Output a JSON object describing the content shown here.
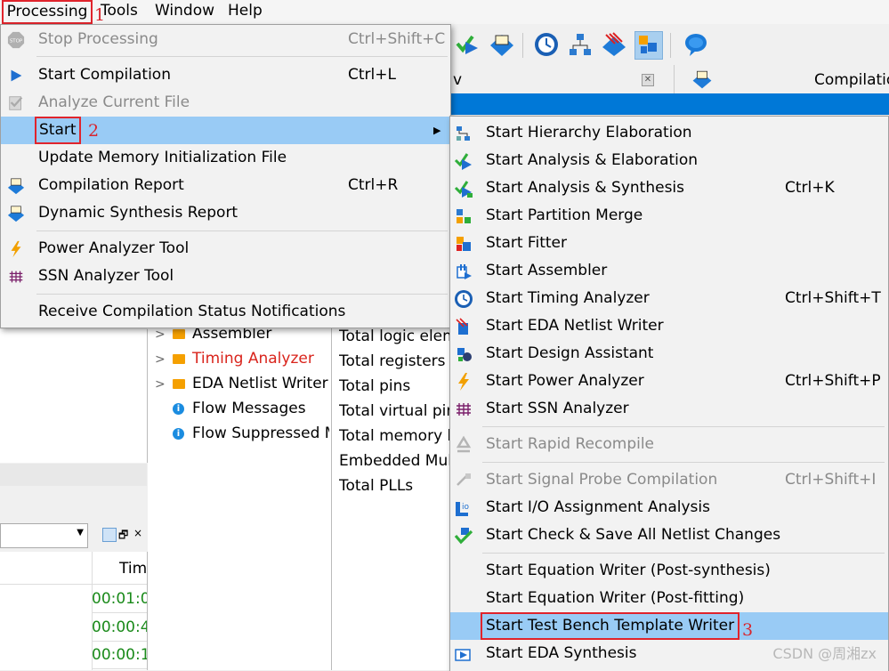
{
  "menubar": {
    "items": [
      "Processing",
      "Tools",
      "Window",
      "Help"
    ]
  },
  "steps": {
    "one": "1",
    "two": "2",
    "three": "3"
  },
  "tabs": {
    "left_fragment": "v",
    "right_fragment": "Compilatio"
  },
  "tree": [
    {
      "label": "Assembler",
      "type": "folder",
      "color": "#000000"
    },
    {
      "label": "Timing Analyzer",
      "type": "folder",
      "color": "#d9241c"
    },
    {
      "label": "EDA Netlist Writer",
      "type": "folder",
      "color": "#000000"
    },
    {
      "label": "Flow Messages",
      "type": "info",
      "color": "#000000"
    },
    {
      "label": "Flow Suppressed M",
      "type": "info",
      "color": "#000000"
    }
  ],
  "summary": [
    "Total logic elem",
    "Total registers",
    "Total pins",
    "Total virtual pin",
    "Total memory b",
    "Embedded Mult",
    "Total PLLs"
  ],
  "messages": {
    "column_header": "Tim",
    "times": [
      "00:01:0",
      "00:00:4",
      "00:00:1"
    ]
  },
  "processing_menu": {
    "items": [
      {
        "label": "Stop Processing",
        "shortcut": "Ctrl+Shift+C",
        "icon": "stop-icon",
        "enabled": false
      },
      {
        "label": "Start Compilation",
        "shortcut": "Ctrl+L",
        "icon": "play-icon",
        "enabled": true
      },
      {
        "label": "Analyze Current File",
        "shortcut": "",
        "icon": "analyze-file-icon",
        "enabled": false
      },
      {
        "label": "Start",
        "shortcut": "",
        "icon": "",
        "enabled": true,
        "highlighted": true,
        "submenu": true
      },
      {
        "label": "Update Memory Initialization File",
        "shortcut": "",
        "icon": "",
        "enabled": true
      },
      {
        "label": "Compilation Report",
        "shortcut": "Ctrl+R",
        "icon": "report-icon",
        "enabled": true
      },
      {
        "label": "Dynamic Synthesis Report",
        "shortcut": "",
        "icon": "report-icon",
        "enabled": true
      },
      {
        "label": "Power Analyzer Tool",
        "shortcut": "",
        "icon": "lightning-icon",
        "enabled": true
      },
      {
        "label": "SSN Analyzer Tool",
        "shortcut": "",
        "icon": "grid-icon",
        "enabled": true
      },
      {
        "label": "Receive Compilation Status Notifications",
        "shortcut": "",
        "icon": "",
        "enabled": true
      }
    ]
  },
  "start_submenu": {
    "items": [
      {
        "label": "Start Hierarchy Elaboration",
        "shortcut": "",
        "icon": "hierarchy-icon",
        "enabled": true
      },
      {
        "label": "Start Analysis & Elaboration",
        "shortcut": "",
        "icon": "check-play-icon",
        "enabled": true
      },
      {
        "label": "Start Analysis & Synthesis",
        "shortcut": "Ctrl+K",
        "icon": "check-play-icon",
        "enabled": true
      },
      {
        "label": "Start Partition Merge",
        "shortcut": "",
        "icon": "partition-icon",
        "enabled": true
      },
      {
        "label": "Start Fitter",
        "shortcut": "",
        "icon": "fitter-icon",
        "enabled": true
      },
      {
        "label": "Start Assembler",
        "shortcut": "",
        "icon": "assembler-icon",
        "enabled": true
      },
      {
        "label": "Start Timing Analyzer",
        "shortcut": "Ctrl+Shift+T",
        "icon": "clock-icon",
        "enabled": true
      },
      {
        "label": "Start EDA Netlist Writer",
        "shortcut": "",
        "icon": "eda-netlist-icon",
        "enabled": true
      },
      {
        "label": "Start Design Assistant",
        "shortcut": "",
        "icon": "design-assistant-icon",
        "enabled": true
      },
      {
        "label": "Start Power Analyzer",
        "shortcut": "Ctrl+Shift+P",
        "icon": "lightning-icon",
        "enabled": true
      },
      {
        "label": "Start SSN Analyzer",
        "shortcut": "",
        "icon": "grid-icon",
        "enabled": true
      },
      {
        "label": "Start Rapid Recompile",
        "shortcut": "",
        "icon": "recycle-icon",
        "enabled": false
      },
      {
        "label": "Start Signal Probe Compilation",
        "shortcut": "Ctrl+Shift+I",
        "icon": "probe-icon",
        "enabled": false
      },
      {
        "label": "Start I/O Assignment Analysis",
        "shortcut": "",
        "icon": "io-icon",
        "enabled": true
      },
      {
        "label": "Start Check & Save All Netlist Changes",
        "shortcut": "",
        "icon": "check-save-icon",
        "enabled": true
      },
      {
        "label": "Start Equation Writer (Post-synthesis)",
        "shortcut": "",
        "icon": "",
        "enabled": true
      },
      {
        "label": "Start Equation Writer (Post-fitting)",
        "shortcut": "",
        "icon": "",
        "enabled": true
      },
      {
        "label": "Start Test Bench Template Writer",
        "shortcut": "",
        "icon": "",
        "enabled": true,
        "highlighted": true
      },
      {
        "label": "Start EDA Synthesis",
        "shortcut": "",
        "icon": "eda-synthesis-icon",
        "enabled": true
      }
    ]
  },
  "watermark": "CSDN @周湘zx",
  "colors": {
    "highlight": "#99cbf5",
    "annotation": "#e0242c",
    "accent": "#0078d7"
  }
}
